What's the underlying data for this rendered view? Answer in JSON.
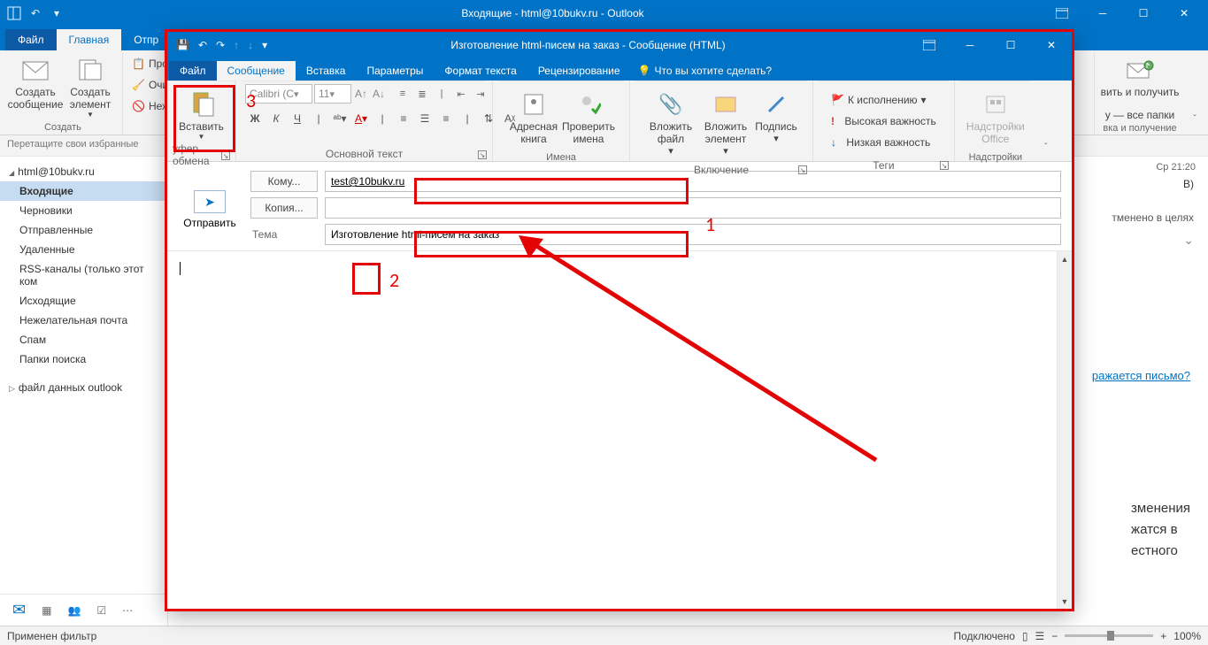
{
  "app": {
    "title": "Входящие - html@10bukv.ru - Outlook",
    "qat_arrow": "▾"
  },
  "tabs": {
    "file": "Файл",
    "home": "Главная",
    "sendreceive_partial": "Отпр"
  },
  "ribbon_main": {
    "new_mail": "Создать сообщение",
    "new_item": "Создать элемент",
    "group_create": "Создать",
    "prof": "Про",
    "ochi": "Очи",
    "nez": "Неж",
    "sendrecv1": "вить и получить",
    "sendrecv2": "у — все папки",
    "group_sendrecv": "вка и получение"
  },
  "favbar": "Перетащите свои избранные",
  "nav": {
    "account": "html@10bukv.ru",
    "folders": [
      "Входящие",
      "Черновики",
      "Отправленные",
      "Удаленные",
      "RSS-каналы (только этот ком",
      "Исходящие",
      "Нежелательная почта",
      "Спам",
      "Папки поиска"
    ],
    "account2": "файл данных outlook"
  },
  "preview": {
    "time": "Ср 21:20",
    "partial1": "В)",
    "partial2": "тменено в целях",
    "link": "ражается письмо?",
    "body": "зменения\nжатся в\nестного"
  },
  "status": {
    "left": "Применен фильтр",
    "connected": "Подключено",
    "zoom": "100%"
  },
  "compose": {
    "title": "Изготовление html-писем на заказ - Сообщение (HTML)",
    "tabs": {
      "file": "Файл",
      "message": "Сообщение",
      "insert": "Вставка",
      "options": "Параметры",
      "format": "Формат текста",
      "review": "Рецензирование",
      "tell": "Что вы хотите сделать?"
    },
    "ribbon": {
      "paste": "Вставить",
      "clipboard": "уфер обмена",
      "font_name": "Calibri (С",
      "font_size": "11",
      "basictext": "Основной текст",
      "addrbook": "Адресная книга",
      "checknames": "Проверить имена",
      "names": "Имена",
      "attachfile": "Вложить файл",
      "attachitem": "Вложить элемент",
      "signature": "Подпись",
      "include": "Включение",
      "followup": "К исполнению",
      "highimp": "Высокая важность",
      "lowimp": "Низкая важность",
      "tags": "Теги",
      "addins": "Надстройки Office",
      "addinsgrp": "Надстройки"
    },
    "send": "Отправить",
    "fields": {
      "to_btn": "Кому...",
      "to_val": "test@10bukv.ru",
      "cc_btn": "Копия...",
      "subj_lbl": "Тема",
      "subj_val": "Изготовление html-писем на заказ"
    }
  },
  "annot": {
    "n1": "1",
    "n2": "2",
    "n3": "3"
  }
}
